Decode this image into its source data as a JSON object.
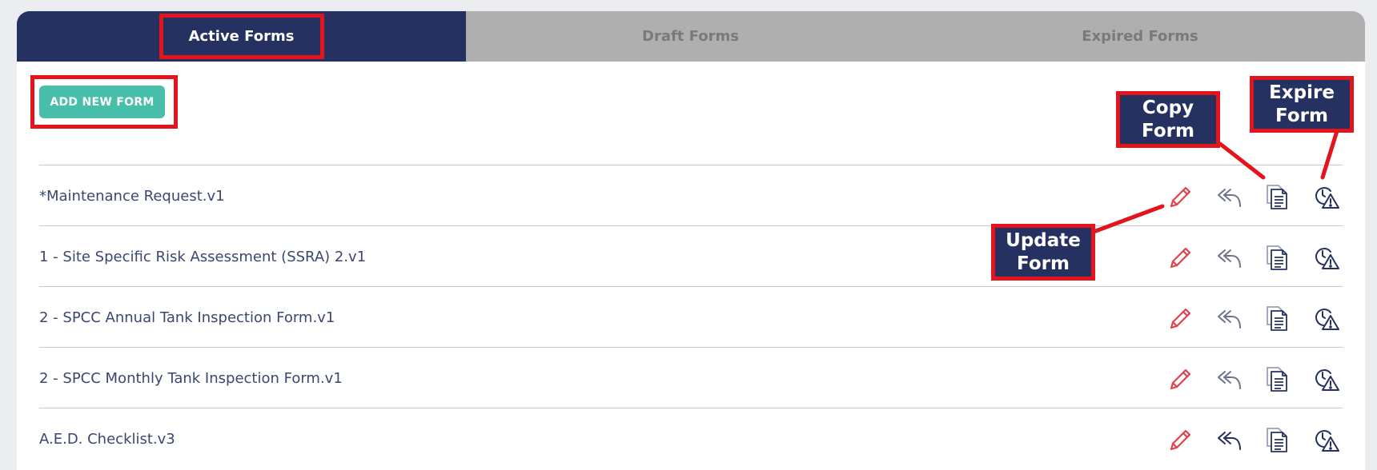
{
  "tabs": [
    {
      "label": "Active Forms",
      "active": true
    },
    {
      "label": "Draft Forms",
      "active": false
    },
    {
      "label": "Expired Forms",
      "active": false
    }
  ],
  "add_button_label": "ADD NEW FORM",
  "forms": [
    {
      "name": "*Maintenance Request.v1"
    },
    {
      "name": "1 - Site Specific Risk Assessment (SSRA) 2.v1"
    },
    {
      "name": "2 - SPCC Annual Tank Inspection Form.v1"
    },
    {
      "name": "2 - SPCC Monthly Tank Inspection Form.v1"
    },
    {
      "name": "A.E.D. Checklist.v3"
    }
  ],
  "row_actions": [
    "pencil-icon",
    "share-icon",
    "copy-icon",
    "expire-icon"
  ],
  "callouts": {
    "copy": "Copy\nForm",
    "expire": "Expire\nForm",
    "update": "Update\nForm"
  },
  "colors": {
    "navy": "#253160",
    "tab_inactive": "#afafaf",
    "accent_teal": "#47bfaa",
    "edit_red": "#e0434d",
    "highlight_red": "#e3141b",
    "text": "#3c4670"
  }
}
